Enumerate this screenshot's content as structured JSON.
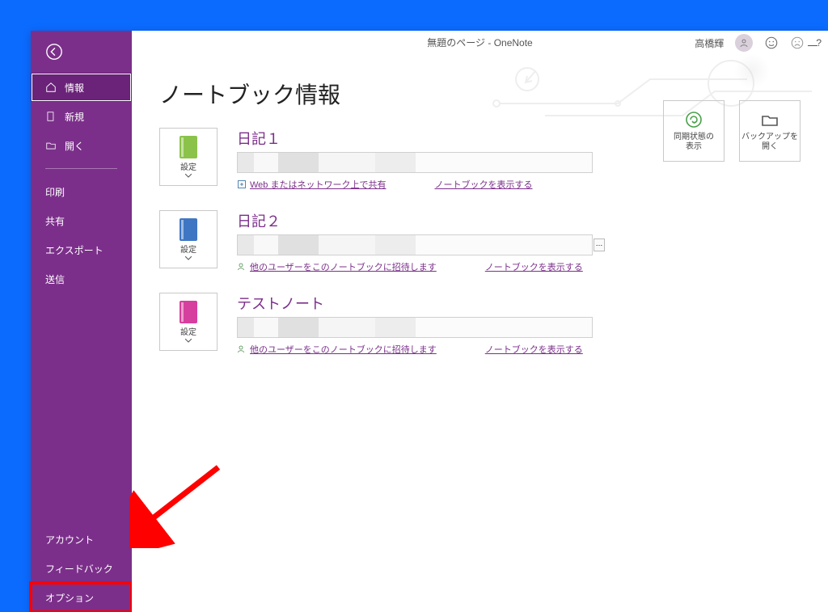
{
  "window": {
    "title": "無題のページ  -  OneNote",
    "user_name": "高橋輝"
  },
  "sidebar": {
    "back_label": "戻る",
    "items_top": [
      {
        "icon": "home",
        "label": "情報",
        "selected": true
      },
      {
        "icon": "doc",
        "label": "新規",
        "selected": false
      },
      {
        "icon": "open",
        "label": "開く",
        "selected": false
      }
    ],
    "items_mid": [
      {
        "label": "印刷"
      },
      {
        "label": "共有"
      },
      {
        "label": "エクスポート"
      },
      {
        "label": "送信"
      }
    ],
    "items_bottom": [
      {
        "label": "アカウント"
      },
      {
        "label": "フィードバック"
      },
      {
        "label": "オプション",
        "highlight": true
      }
    ]
  },
  "page": {
    "title": "ノートブック情報"
  },
  "notebooks": [
    {
      "name": "日記１",
      "icon_color": "#8bc34a",
      "settings_label": "設定",
      "link1_label": "Web またはネットワーク上で共有",
      "link1_icon": "share",
      "link2_label": "ノートブックを表示する"
    },
    {
      "name": "日記２",
      "icon_color": "#3f76c3",
      "settings_label": "設定",
      "link1_label": "他のユーザーをこのノートブックに招待します",
      "link1_icon": "person",
      "link2_label": "ノートブックを表示する"
    },
    {
      "name": "テストノート",
      "icon_color": "#d63f9e",
      "settings_label": "設定",
      "link1_label": "他のユーザーをこのノートブックに招待します",
      "link1_icon": "person",
      "link2_label": "ノートブックを表示する"
    }
  ],
  "actions": {
    "sync_label": "同期状態の\n表示",
    "backup_label": "バックアップを\n開く"
  },
  "annotation": {
    "arrow_target": "オプション"
  }
}
